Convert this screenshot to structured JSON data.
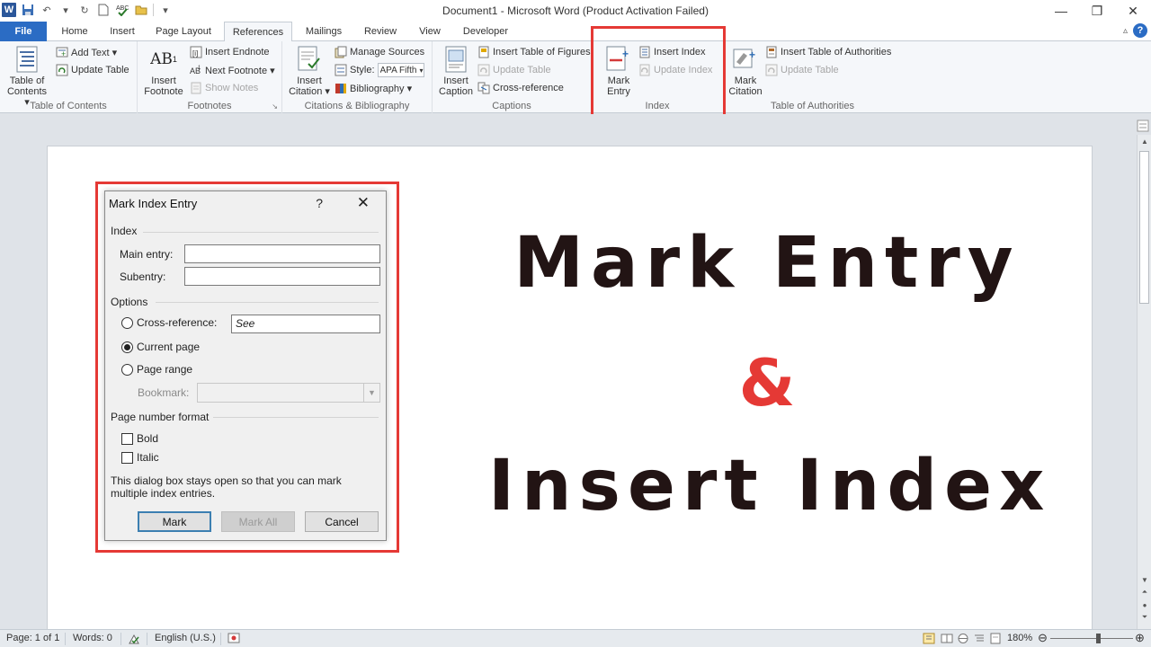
{
  "window": {
    "title": "Document1  -  Microsoft Word (Product Activation Failed)",
    "controls": [
      "—",
      "❐",
      "✕"
    ]
  },
  "tabs": [
    "File",
    "Home",
    "Insert",
    "Page Layout",
    "References",
    "Mailings",
    "Review",
    "View",
    "Developer"
  ],
  "active_tab": "References",
  "ribbon": {
    "toc": {
      "button": "Table of\nContents ▾",
      "add_text": "Add Text ▾",
      "update_table": "Update Table",
      "label": "Table of Contents"
    },
    "footnotes": {
      "insert_footnote": "Insert\nFootnote",
      "insert_endnote": "Insert Endnote",
      "next_footnote": "Next Footnote ▾",
      "show_notes": "Show Notes",
      "label": "Footnotes",
      "icon_text": "AB"
    },
    "citations": {
      "insert_citation": "Insert\nCitation ▾",
      "manage_sources": "Manage Sources",
      "style_label": "Style:",
      "style_value": "APA Fifth",
      "bibliography": "Bibliography ▾",
      "label": "Citations & Bibliography"
    },
    "captions": {
      "insert_caption": "Insert\nCaption",
      "insert_table_of_figures": "Insert Table of Figures",
      "update_table": "Update Table",
      "cross_reference": "Cross-reference",
      "label": "Captions"
    },
    "index": {
      "mark_entry": "Mark\nEntry",
      "insert_index": "Insert Index",
      "update_index": "Update Index",
      "label": "Index"
    },
    "authorities": {
      "mark_citation": "Mark\nCitation",
      "insert_table_of_authorities": "Insert Table of Authorities",
      "update_table": "Update Table",
      "label": "Table of Authorities"
    }
  },
  "document": {
    "heading1": "Mark Entry",
    "ampersand": "&",
    "heading2": "Insert Index"
  },
  "dialog": {
    "title": "Mark Index Entry",
    "help": "?",
    "close": "✕",
    "index_section": "Index",
    "main_entry_label": "Main entry:",
    "main_entry_value": "",
    "subentry_label": "Subentry:",
    "subentry_value": "",
    "options_section": "Options",
    "cross_reference_label": "Cross-reference:",
    "cross_reference_value": "See",
    "current_page_label": "Current page",
    "page_range_label": "Page range",
    "bookmark_label": "Bookmark:",
    "page_number_format_section": "Page number format",
    "bold_label": "Bold",
    "italic_label": "Italic",
    "note": "This dialog box stays open so that you can mark multiple index entries.",
    "mark_button": "Mark",
    "mark_all_button": "Mark All",
    "cancel_button": "Cancel",
    "selected_option": "Current page"
  },
  "statusbar": {
    "page": "Page: 1 of 1",
    "words": "Words: 0",
    "language": "English (U.S.)",
    "zoom": "180%"
  },
  "colors": {
    "accent": "#2b6cc4",
    "highlight": "#e53935",
    "heading_text": "#221414"
  }
}
